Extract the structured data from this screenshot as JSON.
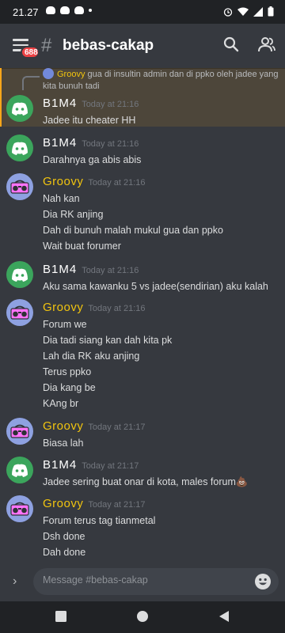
{
  "status": {
    "time": "21.27"
  },
  "header": {
    "channel": "bebas-cakap",
    "badge": "6882",
    "hash": "#"
  },
  "reply": {
    "author": "Groovy",
    "text": "gua di insultin admin dan di ppko oleh jadee yang kita bunuh tadi"
  },
  "messages": [
    {
      "author": "B1M4",
      "avatar": "discord",
      "time": "Today at 21:16",
      "lines": [
        "Jadee itu cheater HH"
      ]
    },
    {
      "author": "B1M4",
      "avatar": "discord",
      "time": "Today at 21:16",
      "lines": [
        "Darahnya ga abis abis"
      ]
    },
    {
      "author": "Groovy",
      "avatar": "groovy",
      "time": "Today at 21:16",
      "lines": [
        "Nah kan",
        "Dia RK anjing",
        "Dah di bunuh malah mukul gua dan ppko",
        "Wait buat forumer"
      ]
    },
    {
      "author": "B1M4",
      "avatar": "discord",
      "time": "Today at 21:16",
      "lines": [
        "Aku sama  kawanku 5 vs jadee(sendirian) aku kalah"
      ]
    },
    {
      "author": "Groovy",
      "avatar": "groovy",
      "time": "Today at 21:16",
      "lines": [
        "Forum we",
        "Dia tadi siang kan dah kita pk",
        "Lah dia RK aku anjing",
        "Terus ppko",
        "Dia kang be",
        "KAng br"
      ]
    },
    {
      "author": "Groovy",
      "avatar": "groovy",
      "time": "Today at 21:17",
      "lines": [
        "Biasa lah"
      ]
    },
    {
      "author": "B1M4",
      "avatar": "discord",
      "time": "Today at 21:17",
      "lines": [
        "Jadee sering buat onar di kota, males forum💩"
      ]
    },
    {
      "author": "Groovy",
      "avatar": "groovy",
      "time": "Today at 21:17",
      "lines": [
        "Forum terus tag tianmetal",
        "Dsh done",
        "Dah done"
      ]
    }
  ],
  "composer": {
    "placeholder": "Message #bebas-cakap",
    "expand": "›"
  },
  "colors": {
    "discord_green": "#3ba55c",
    "groovy_yellow": "#f1c40f",
    "badge_red": "#ed4245",
    "reply_highlight": "#faa61a"
  },
  "icons": [
    "menu-icon",
    "search-icon",
    "members-icon",
    "emoji-icon",
    "discord-logo-icon",
    "boombox-icon",
    "nav-back-icon",
    "nav-home-icon",
    "nav-recents-icon"
  ]
}
